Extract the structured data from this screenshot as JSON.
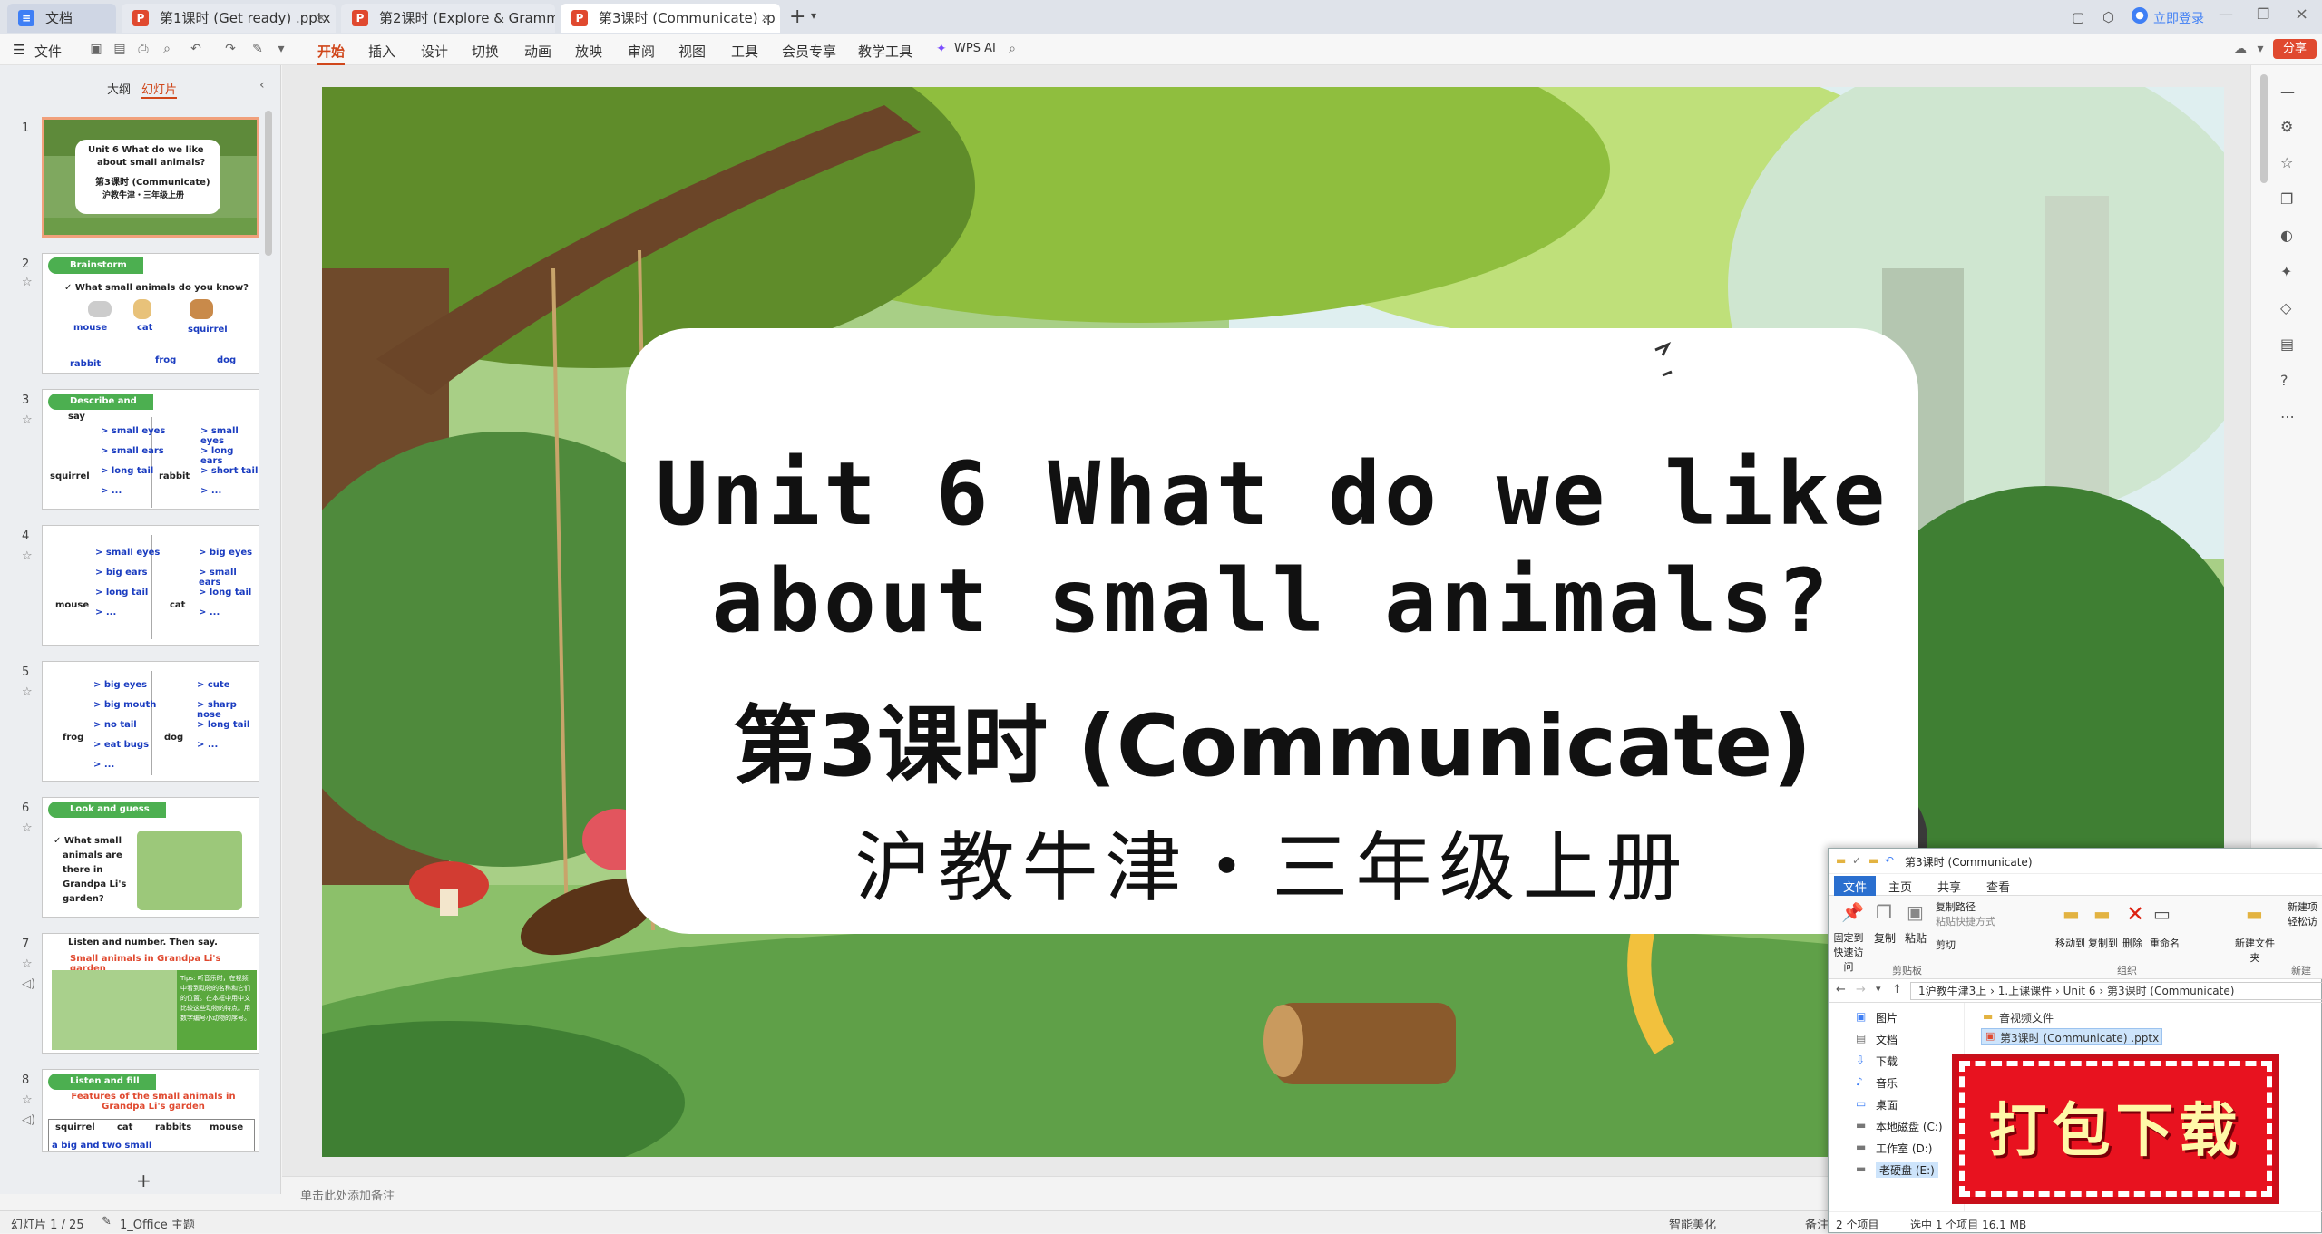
{
  "tabs": [
    {
      "label": "文档",
      "icon": "W",
      "color": "#3f7ff5"
    },
    {
      "label": "第1课时 (Get ready) .pptx",
      "icon": "P",
      "color": "#e0492f"
    },
    {
      "label": "第2课时 (Explore & Grammar in u",
      "icon": "P",
      "color": "#e0492f"
    },
    {
      "label": "第3课时 (Communicate) .p",
      "icon": "P",
      "color": "#e0492f"
    }
  ],
  "titlebar": {
    "login": "立即登录",
    "share": "分享"
  },
  "menu": {
    "file": "文件",
    "items": [
      "开始",
      "插入",
      "设计",
      "切换",
      "动画",
      "放映",
      "审阅",
      "视图",
      "工具",
      "会员专享",
      "教学工具"
    ],
    "ai": "WPS AI"
  },
  "panel": {
    "outline": "大纲",
    "slides": "幻灯片"
  },
  "thumbs": {
    "t1": {
      "l1": "Unit 6 What do we like",
      "l2": "about small animals?",
      "l3": "第3课时 (Communicate)",
      "l4": "沪教牛津・三年级上册"
    },
    "t2": {
      "head": "Brainstorm",
      "q": "✓ What small animals do you know?",
      "a": "mouse",
      "b": "cat",
      "c": "squirrel",
      "d": "rabbit",
      "e": "frog",
      "f": "dog"
    },
    "t3": {
      "head": "Describe and",
      "say": "say",
      "l1": "> small eyes",
      "l2": "> small ears",
      "l3": "> long tail",
      "l4": "> ...",
      "n1": "squirrel",
      "r1": "> small eyes",
      "r2": "> long ears",
      "r3": "> short tail",
      "r4": "> ...",
      "n2": "rabbit"
    },
    "t4": {
      "l1": "> small eyes",
      "l2": "> big ears",
      "l3": "> long tail",
      "l4": "> ...",
      "n1": "mouse",
      "r1": "> big eyes",
      "r2": "> small ears",
      "r3": "> long tail",
      "r4": "> ...",
      "n2": "cat"
    },
    "t5": {
      "l1": "> big eyes",
      "l2": "> big mouth",
      "l3": "> no tail",
      "l4": "> eat bugs",
      "l5": "> ...",
      "n1": "frog",
      "r1": "> cute",
      "r2": "> sharp nose",
      "r3": "> long tail",
      "r4": "> ...",
      "n2": "dog"
    },
    "t6": {
      "head": "Look and guess",
      "l1": "✓ What small",
      "l2": "animals are",
      "l3": "there in",
      "l4": "Grandpa Li's",
      "l5": "garden?"
    },
    "t7": {
      "head": "Listen and number. Then say.",
      "sub": "Small animals in Grandpa Li's garden",
      "tips": "Tips: 听音乐时，在视频中看到动物的名称和它们的位置。在本框中用中文比较这些动物的特点。用数字编号小动物的序号。"
    },
    "t8": {
      "head": "Listen and fill",
      "sub": "Features of the small animals in Grandpa Li's garden",
      "c1": "squirrel",
      "c2": "cat",
      "c3": "rabbits",
      "c4": "mouse",
      "r1": "a big and",
      "r2": "two small"
    }
  },
  "slide": {
    "title1": "Unit 6  What do we like",
    "title2": "about small animals?",
    "lesson": "第3课时 (Communicate)",
    "book": "沪教牛津・三年级上册"
  },
  "notes_placeholder": "单击此处添加备注",
  "status": {
    "slide": "幻灯片 1 / 25",
    "theme": "1_Office 主题",
    "beautify": "智能美化",
    "notes": "备注"
  },
  "explorer": {
    "title": "第3课时 (Communicate)",
    "tabs": [
      "文件",
      "主页",
      "共享",
      "查看"
    ],
    "ribbon": {
      "pin": "固定到快速访问",
      "copy": "复制",
      "paste": "粘贴",
      "copypath": "复制路径",
      "pasteshort": "粘贴快捷方式",
      "cut": "剪切",
      "clipboard": "剪贴板",
      "moveto": "移动到",
      "copyto": "复制到",
      "delete": "删除",
      "rename": "重命名",
      "organize": "组织",
      "newfolder": "新建文件夹",
      "new": "新建",
      "newitem": "新建项",
      "easyaccess": "轻松访"
    },
    "path": [
      "1沪教牛津3上",
      "1.上课课件",
      "Unit 6",
      "第3课时 (Communicate)"
    ],
    "nav": [
      "图片",
      "文档",
      "下载",
      "音乐",
      "桌面",
      "本地磁盘 (C:)",
      "工作室 (D:)",
      "老硬盘 (E:)"
    ],
    "files": [
      "音视频文件",
      "第3课时 (Communicate) .pptx"
    ],
    "status_count": "2 个项目",
    "status_sel": "选中 1 个项目  16.1 MB"
  },
  "download_banner": "打包下载",
  "colors": {
    "accent": "#e0492f",
    "sel_border": "#f1a07b",
    "green": "#4caf50",
    "banner": "#e8121f"
  }
}
